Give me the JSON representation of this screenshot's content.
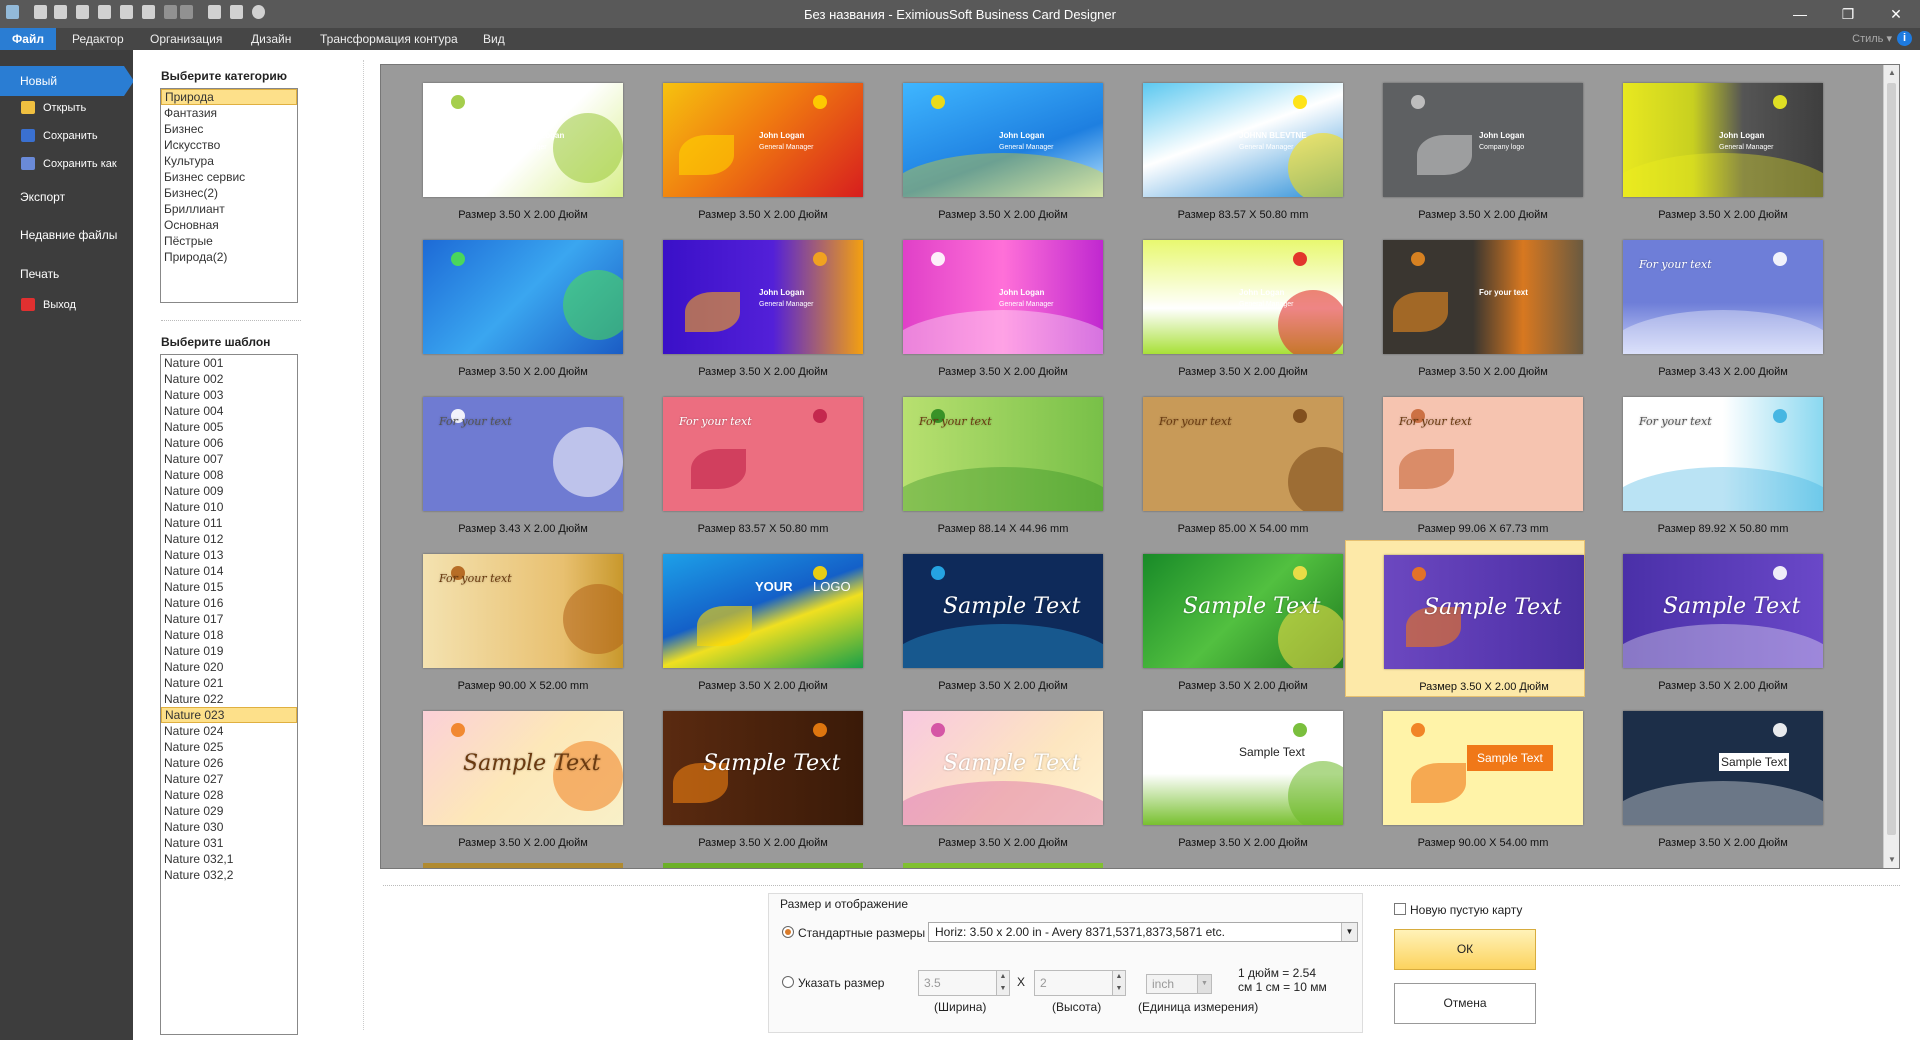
{
  "window": {
    "title": "Без названия - EximiousSoft Business Card Designer",
    "minimize": "—",
    "maximize": "❐",
    "close": "✕"
  },
  "menubar": {
    "tabs": [
      "Файл",
      "Редактор",
      "Организация",
      "Дизайн",
      "Трансформация контура",
      "Вид"
    ],
    "style_label": "Стиль ▾",
    "help_glyph": "i"
  },
  "sidebar": {
    "new": "Новый",
    "open": "Открыть",
    "save": "Сохранить",
    "save_as": "Сохранить как",
    "export": "Экспорт",
    "recent": "Недавние файлы",
    "print": "Печать",
    "exit": "Выход"
  },
  "categories": {
    "title": "Выберите категорию",
    "items": [
      "Природа",
      "Фантазия",
      "Бизнес",
      "Искусство",
      "Культура",
      "Бизнес сервис",
      "Бизнес(2)",
      "Бриллиант",
      "Основная",
      "Пёстрые",
      "Природа(2)"
    ],
    "selected": "Природа"
  },
  "templates": {
    "title": "Выберите шаблон",
    "items": [
      "Nature 001",
      "Nature 002",
      "Nature 003",
      "Nature 004",
      "Nature 005",
      "Nature 006",
      "Nature 007",
      "Nature 008",
      "Nature 009",
      "Nature 010",
      "Nature 011",
      "Nature 012",
      "Nature 013",
      "Nature 014",
      "Nature 015",
      "Nature 016",
      "Nature 017",
      "Nature 018",
      "Nature 019",
      "Nature 020",
      "Nature 021",
      "Nature 022",
      "Nature 023",
      "Nature 024",
      "Nature 025",
      "Nature 026",
      "Nature 027",
      "Nature 028",
      "Nature 029",
      "Nature 030",
      "Nature 031",
      "Nature 032,1",
      "Nature 032,2"
    ],
    "selected": "Nature 023"
  },
  "gallery": {
    "selected_index": 22,
    "cards": [
      {
        "label": "Размер 3.50 X 2.00 Дюйм",
        "bg": "linear-gradient(135deg,#fff 55%,#d8ef8a 100%)",
        "accent": "#9bc93a",
        "text1": "John Logan",
        "text2": "Manager",
        "script": ""
      },
      {
        "label": "Размер 3.50 X 2.00 Дюйм",
        "bg": "linear-gradient(135deg,#f6c20f 0%,#f07a10 45%,#d71e1e 100%)",
        "accent": "#ffd400",
        "text1": "John Logan",
        "text2": "General Manager",
        "script": ""
      },
      {
        "label": "Размер 3.50 X 2.00 Дюйм",
        "bg": "linear-gradient(160deg,#3fb6ff 0%,#1e7fe0 60%,#bfe8ff 100%)",
        "accent": "#ffe000",
        "text1": "John Logan",
        "text2": "General Manager",
        "script": ""
      },
      {
        "label": "Размер 83.57 X 50.80 mm",
        "bg": "linear-gradient(160deg,#5cc8f0 0%,#fff 45%,#2c8fd8 100%)",
        "accent": "#ffe000",
        "text1": "JOHNN BLEVTNE",
        "text2": "General Manager",
        "script": ""
      },
      {
        "label": "Размер 3.50 X 2.00 Дюйм",
        "bg": "#5e6062",
        "accent": "#c8c8c8",
        "text1": "John Logan",
        "text2": "Company logo",
        "script": ""
      },
      {
        "label": "Размер 3.50 X 2.00 Дюйм",
        "bg": "linear-gradient(90deg,#e8e820 0%,#c8d020 35%,#555 60%,#3e3e3e 100%)",
        "accent": "#f0f020",
        "text1": "John Logan",
        "text2": "General Manager",
        "script": ""
      },
      {
        "label": "Размер 3.50 X 2.00 Дюйм",
        "bg": "linear-gradient(135deg,#1d6ad6 0%,#3aa6f0 50%,#1b5cc4 100%)",
        "accent": "#4ee04e",
        "text1": "",
        "text2": "",
        "script": ""
      },
      {
        "label": "Размер 3.50 X 2.00 Дюйм",
        "bg": "linear-gradient(90deg,#3a10c8 0%,#5320d8 55%,#f4a010 100%)",
        "accent": "#f8a818",
        "text1": "John Logan",
        "text2": "General Manager",
        "script": ""
      },
      {
        "label": "Размер 3.50 X 2.00 Дюйм",
        "bg": "linear-gradient(90deg,#e040c8 0%,#ff70d8 50%,#c028d0 100%)",
        "accent": "#fff",
        "text1": "John Logan",
        "text2": "General Manager",
        "script": ""
      },
      {
        "label": "Размер 3.50 X 2.00 Дюйм",
        "bg": "linear-gradient(180deg,#e8f870 0%,#fff 60%,#a8e038 100%)",
        "accent": "#e02020",
        "text1": "John Logan",
        "text2": "General Manager",
        "script": ""
      },
      {
        "label": "Размер 3.50 X 2.00 Дюйм",
        "bg": "linear-gradient(90deg,#3a3630 0%,#3a3630 45%,#d87820 70%,#6a5a40 100%)",
        "accent": "#e88a20",
        "text1": "For your text",
        "text2": "",
        "script": ""
      },
      {
        "label": "Размер 3.43 X 2.00 Дюйм",
        "bg": "linear-gradient(180deg,#6e7ed8 0%,#6e7ed8 55%,#c8d0f8 100%)",
        "accent": "#fff",
        "text1": "",
        "text2": "",
        "script": "For your text"
      },
      {
        "label": "Размер 3.43 X 2.00 Дюйм",
        "bg": "#6f7bd2",
        "accent": "#fff",
        "text1": "",
        "text2": "",
        "script": "For your text"
      },
      {
        "label": "Размер 83.57 X 50.80 mm",
        "bg": "#ec6e80",
        "accent": "#c02048",
        "text1": "",
        "text2": "",
        "script": "For your text"
      },
      {
        "label": "Размер 88.14 X 44.96 mm",
        "bg": "linear-gradient(90deg,#b8e070 0%,#78c048 100%)",
        "accent": "#2c8a20",
        "text1": "",
        "text2": "",
        "script": "For your text"
      },
      {
        "label": "Размер 85.00 X 54.00 mm",
        "bg": "#c89a58",
        "accent": "#7a4818",
        "text1": "",
        "text2": "",
        "script": "For your text"
      },
      {
        "label": "Размер 99.06 X 67.73 mm",
        "bg": "#f6c4b0",
        "accent": "#c86838",
        "text1": "",
        "text2": "",
        "script": "For your text"
      },
      {
        "label": "Размер 89.92 X 50.80 mm",
        "bg": "linear-gradient(90deg,#fff 0%,#fff 50%,#8ad8f0 100%)",
        "accent": "#3ab0e0",
        "text1": "",
        "text2": "",
        "script": "For your text"
      },
      {
        "label": "Размер 90.00 X 52.00 mm",
        "bg": "linear-gradient(90deg,#f4e2b0 0%,#e8c070 70%,#c8982c 100%)",
        "accent": "#b06018",
        "text1": "",
        "text2": "",
        "script": "For your text"
      },
      {
        "label": "Размер 3.50 X 2.00 Дюйм",
        "bg": "linear-gradient(160deg,#1da0e8 0%,#1460c8 45%,#f0e020 60%,#18a048 100%)",
        "accent": "#ffd800",
        "text1": "YOUR",
        "text2": "LOGO",
        "script": ""
      },
      {
        "label": "Размер 3.50 X 2.00 Дюйм",
        "bg": "#0e2a5a",
        "accent": "#28b0f0",
        "text1": "",
        "text2": "",
        "script": "Sample Text"
      },
      {
        "label": "Размер 3.50 X 2.00 Дюйм",
        "bg": "linear-gradient(135deg,#188a28 0%,#52c040 50%,#1e7a1e 100%)",
        "accent": "#f8e048",
        "text1": "",
        "text2": "",
        "script": "Sample Text"
      },
      {
        "label": "Размер 3.50 X 2.00 Дюйм",
        "bg": "linear-gradient(90deg,#6c48c0 0%,#5838b0 60%,#4a30a0 100%)",
        "accent": "#f07818",
        "text1": "",
        "text2": "",
        "script": "Sample Text"
      },
      {
        "label": "Размер 3.50 X 2.00 Дюйм",
        "bg": "linear-gradient(90deg,#4a30a8 0%,#6a48c8 100%)",
        "accent": "#fff",
        "text1": "",
        "text2": "",
        "script": "Sample Text"
      },
      {
        "label": "Размер 3.50 X 2.00 Дюйм",
        "bg": "linear-gradient(135deg,#fbd0d8 0%,#fde8b8 50%,#f8f0c8 100%)",
        "accent": "#f08020",
        "text1": "",
        "text2": "",
        "script": "Sample Text"
      },
      {
        "label": "Размер 3.50 X 2.00 Дюйм",
        "bg": "linear-gradient(90deg,#5a2a10 0%,#3a1a08 100%)",
        "accent": "#f08010",
        "text1": "",
        "text2": "",
        "script": "Sample Text"
      },
      {
        "label": "Размер 3.50 X 2.00 Дюйм",
        "bg": "linear-gradient(135deg,#f8c8e0 0%,#fde6c0 60%,#fff2d0 100%)",
        "accent": "#d048a0",
        "text1": "",
        "text2": "",
        "script": "Sample Text"
      },
      {
        "label": "Размер 3.50 X 2.00 Дюйм",
        "bg": "linear-gradient(180deg,#fff 0%,#fff 55%,#78c030 100%)",
        "accent": "#6cb828",
        "text1": "",
        "text2": "",
        "script": "",
        "plain": "Sample Text"
      },
      {
        "label": "Размер 90.00 X 54.00 mm",
        "bg": "#fff3a8",
        "accent": "#f07818",
        "text1": "",
        "text2": "",
        "script": "",
        "plain": "Sample Text"
      },
      {
        "label": "Размер 3.50 X 2.00 Дюйм",
        "bg": "#1c2e48",
        "accent": "#fff",
        "text1": "",
        "text2": "",
        "script": "",
        "plain": "Sample Text"
      }
    ]
  },
  "size_panel": {
    "title": "Размер и отображение",
    "standard_label": "Стандартные размеры",
    "preset_value": "Horiz: 3.50 x 2.00 in - Avery 8371,5371,8373,5871 etc.",
    "custom_label": "Указать размер",
    "width_value": "3.5",
    "height_value": "2",
    "times": "X",
    "unit_value": "inch",
    "conversion_1": "1 дюйм = 2.54",
    "conversion_2": "см 1 см = 10 мм",
    "width_caption": "(Ширина)",
    "height_caption": "(Высота)",
    "unit_caption": "(Единица измерения)"
  },
  "actions": {
    "blank_card_label": "Новую пустую карту",
    "ok": "ОК",
    "cancel": "Отмена"
  }
}
